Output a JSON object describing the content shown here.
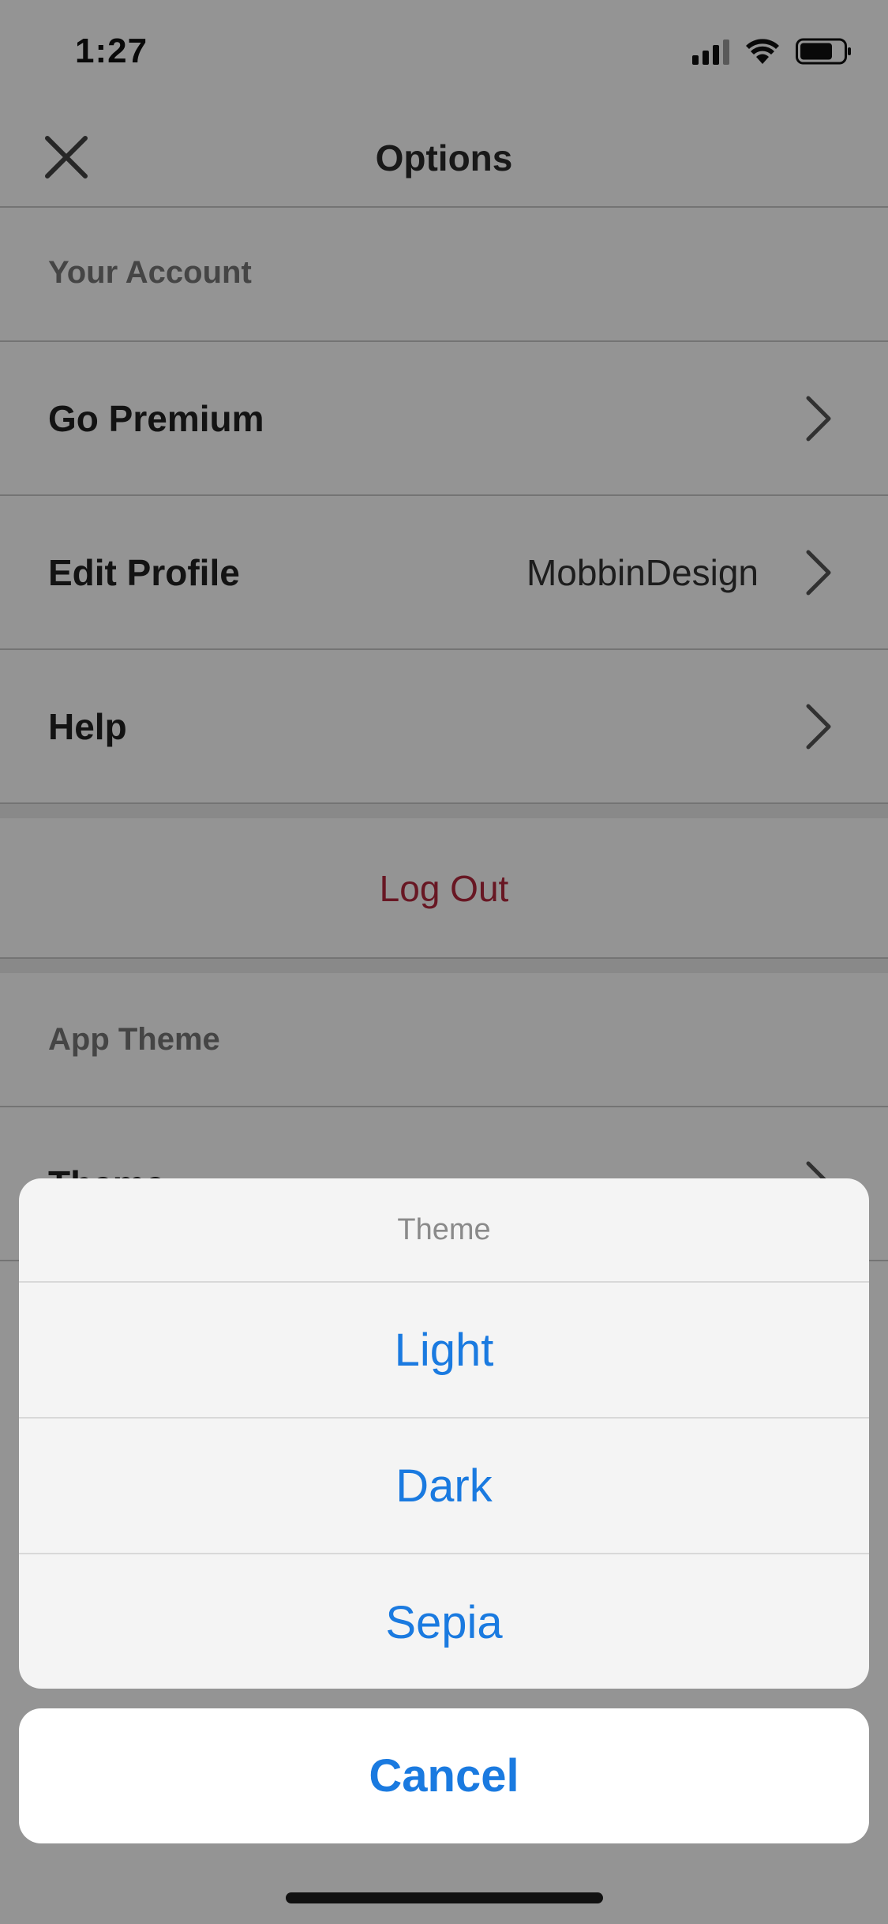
{
  "status_bar": {
    "time": "1:27",
    "icons": [
      "cellular-signal-icon",
      "wifi-icon",
      "battery-icon"
    ]
  },
  "nav": {
    "title": "Options",
    "close_icon": "close-icon"
  },
  "sections": {
    "account_header": "Your Account",
    "items": [
      {
        "label": "Go Premium",
        "value": ""
      },
      {
        "label": "Edit Profile",
        "value": "MobbinDesign"
      },
      {
        "label": "Help",
        "value": ""
      }
    ],
    "logout_label": "Log Out",
    "theme_header": "App Theme",
    "theme_item_label": "Theme"
  },
  "action_sheet": {
    "title": "Theme",
    "options": [
      "Light",
      "Dark",
      "Sepia"
    ],
    "cancel_label": "Cancel"
  },
  "colors": {
    "accent_blue": "#1a7ae0",
    "logout_red": "#b3283d",
    "dim_overlay": "rgba(0,0,0,0.42)"
  }
}
